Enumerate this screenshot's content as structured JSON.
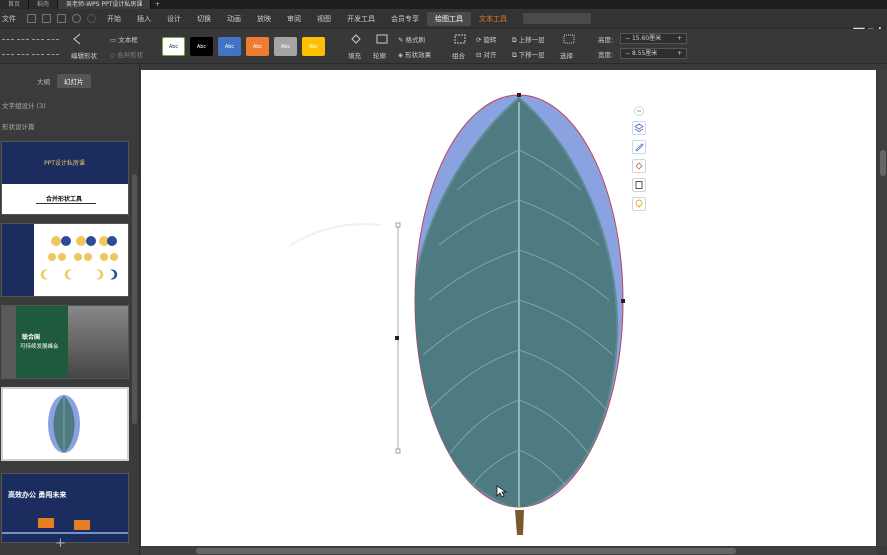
{
  "titlebar": {
    "tabs": [
      {
        "label": "首页",
        "active": false
      },
      {
        "label": "稻壳",
        "active": false
      },
      {
        "label": "吴老师-WPS PPT设计私房课",
        "active": true
      }
    ],
    "new_tab": "+"
  },
  "menubar": {
    "file": "文件",
    "items": [
      {
        "label": "开始"
      },
      {
        "label": "插入"
      },
      {
        "label": "设计"
      },
      {
        "label": "切换"
      },
      {
        "label": "动画"
      },
      {
        "label": "放映"
      },
      {
        "label": "审阅"
      },
      {
        "label": "视图"
      },
      {
        "label": "开发工具"
      },
      {
        "label": "会员专享"
      },
      {
        "label": "绘图工具",
        "active": true
      },
      {
        "label": "文本工具",
        "ctx": true
      }
    ],
    "brand": "吴时"
  },
  "ribbon": {
    "edit_shape": "编辑形状",
    "text_box": "文本框",
    "merge_shape": "合并形状",
    "swatches": [
      {
        "label": "Abc",
        "bg": "#ffffff",
        "fg": "#333333",
        "border": "#70ad47"
      },
      {
        "label": "Abc",
        "bg": "#000000",
        "fg": "#ffffff",
        "border": "#000000"
      },
      {
        "label": "Abc",
        "bg": "#4472c4",
        "fg": "#ffffff",
        "border": "#4472c4"
      },
      {
        "label": "Abc",
        "bg": "#ed7d31",
        "fg": "#ffffff",
        "border": "#ed7d31"
      },
      {
        "label": "Abc",
        "bg": "#a5a5a5",
        "fg": "#ffffff",
        "border": "#a5a5a5"
      },
      {
        "label": "Abc",
        "bg": "#ffc000",
        "fg": "#ffffff",
        "border": "#ffc000"
      }
    ],
    "fill": "填充",
    "outline": "轮廓",
    "format_painter": "格式刷",
    "shape_effects": "形状效果",
    "group": "组合",
    "rotate": "旋转",
    "align": "对齐",
    "bring_forward": "上移一层",
    "send_backward": "下移一层",
    "select": "选择",
    "height_label": "高度:",
    "height_value": "15.60厘米",
    "width_label": "宽度:",
    "width_value": "8.55厘米"
  },
  "leftpanel": {
    "tabs": [
      {
        "label": "大纲",
        "active": false
      },
      {
        "label": "幻灯片",
        "active": true
      }
    ],
    "outline_1": "文字组设计 (3)",
    "outline_2": "形状设计篇",
    "slide1": {
      "title": "PPT设计私房课",
      "caption": "合并形状工具"
    },
    "slide3": {
      "title": "联合国",
      "subtitle": "可持续发展峰会"
    },
    "slide5": {
      "title": "高效办公 勇闯未来"
    },
    "add": "+"
  },
  "colors": {
    "leaf_blue": "#8aa3e0",
    "leaf_green": "#4e7a82",
    "selection": "#c04060",
    "accent_orange": "#e67e22"
  }
}
